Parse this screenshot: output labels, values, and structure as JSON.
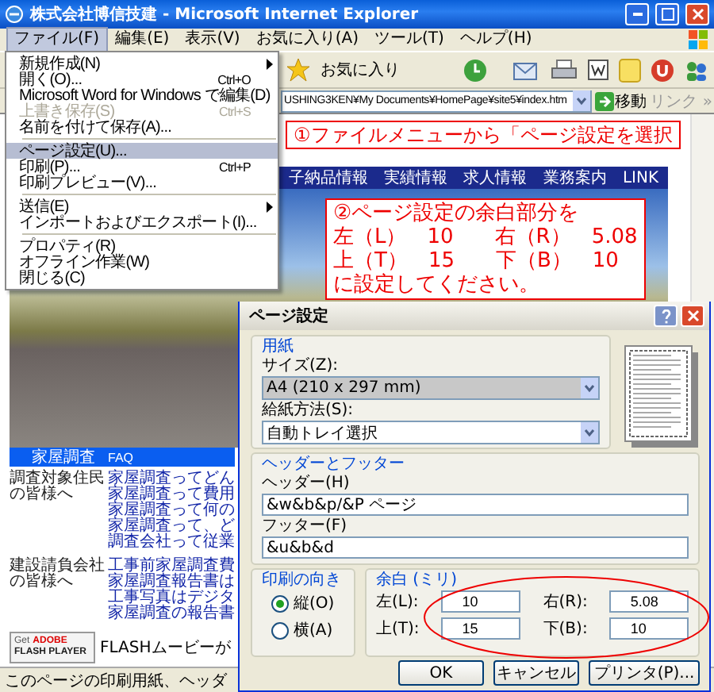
{
  "window": {
    "title": "株式会社博信技建 - Microsoft Internet Explorer"
  },
  "menu_bar": [
    {
      "label": "ファイル(F)",
      "selected": true
    },
    {
      "label": "編集(E)",
      "selected": false
    },
    {
      "label": "表示(V)",
      "selected": false
    },
    {
      "label": "お気に入り(A)",
      "selected": false
    },
    {
      "label": "ツール(T)",
      "selected": false
    },
    {
      "label": "ヘルプ(H)",
      "selected": false
    }
  ],
  "toolbar": {
    "favorites_label": "お気に入り"
  },
  "address_bar": {
    "value": "USHING3KEN¥My Documents¥HomePage¥site5¥index.htm",
    "go_label": "移動",
    "links_label": "リンク »"
  },
  "file_menu": [
    {
      "kind": "item",
      "label": "新規作成(N)",
      "submenu": true,
      "disabled": false,
      "selected": false
    },
    {
      "kind": "item",
      "label": "開く(O)...",
      "shortcut": "Ctrl+O",
      "submenu": false,
      "disabled": false,
      "selected": false
    },
    {
      "kind": "item",
      "label": "Microsoft Word for Windows で編集(D)",
      "submenu": false,
      "disabled": false,
      "selected": false
    },
    {
      "kind": "item",
      "label": "上書き保存(S)",
      "shortcut": "Ctrl+S",
      "submenu": false,
      "disabled": true,
      "selected": false
    },
    {
      "kind": "item",
      "label": "名前を付けて保存(A)...",
      "submenu": false,
      "disabled": false,
      "selected": false
    },
    {
      "kind": "separator"
    },
    {
      "kind": "item",
      "label": "ページ設定(U)...",
      "submenu": false,
      "disabled": false,
      "selected": true
    },
    {
      "kind": "item",
      "label": "印刷(P)...",
      "shortcut": "Ctrl+P",
      "submenu": false,
      "disabled": false,
      "selected": false
    },
    {
      "kind": "item",
      "label": "印刷プレビュー(V)...",
      "submenu": false,
      "disabled": false,
      "selected": false
    },
    {
      "kind": "separator"
    },
    {
      "kind": "item",
      "label": "送信(E)",
      "submenu": true,
      "disabled": false,
      "selected": false
    },
    {
      "kind": "item",
      "label": "インポートおよびエクスポート(I)...",
      "submenu": false,
      "disabled": false,
      "selected": false
    },
    {
      "kind": "separator"
    },
    {
      "kind": "item",
      "label": "プロパティ(R)",
      "submenu": false,
      "disabled": false,
      "selected": false
    },
    {
      "kind": "item",
      "label": "オフライン作業(W)",
      "submenu": false,
      "disabled": false,
      "selected": false
    },
    {
      "kind": "item",
      "label": "閉じる(C)",
      "submenu": false,
      "disabled": false,
      "selected": false
    }
  ],
  "page": {
    "nav": [
      "子納品情報",
      "実績情報",
      "求人情報",
      "業務案内",
      "LINK"
    ],
    "faq_bar": {
      "title": "家屋調査",
      "tag": "FAQ"
    },
    "sections": [
      {
        "heading": "調査対象住民の皆様へ",
        "links": [
          "家屋調査ってどん",
          "家屋調査って費用",
          "家屋調査って何の",
          "家屋調査って、ど",
          "調査会社って従業"
        ]
      },
      {
        "heading": "建設請負会社の皆様へ",
        "links": [
          "工事前家屋調査費",
          "家屋調査報告書は",
          "工事写真はデジタ",
          "家屋調査の報告書"
        ]
      }
    ],
    "flash_badge": {
      "get": "Get",
      "brand": "ADOBE",
      "product": "FLASH PLAYER"
    },
    "flash_note": "FLASHムービーが"
  },
  "callouts": [
    {
      "lines": [
        "①ファイルメニューから「ページ設定を選択"
      ]
    },
    {
      "lines": [
        "②ページ設定の余白部分を",
        "左（L）　10　　右（R）　5.08",
        "上（T）　15　　下（B）　10",
        "に設定してください。"
      ]
    }
  ],
  "dialog": {
    "title": "ページ設定",
    "paper": {
      "legend": "用紙",
      "size_label": "サイズ(Z):",
      "size_value": "A4 (210 x 297 mm)",
      "source_label": "給紙方法(S):",
      "source_value": "自動トレイ選択"
    },
    "header_footer": {
      "legend": "ヘッダーとフッター",
      "header_label": "ヘッダー(H)",
      "header_value": "&w&b&p/&P ページ",
      "footer_label": "フッター(F)",
      "footer_value": "&u&b&d"
    },
    "orientation": {
      "legend": "印刷の向き",
      "options": [
        {
          "label": "縦(O)",
          "selected": true
        },
        {
          "label": "横(A)",
          "selected": false
        }
      ]
    },
    "margins": {
      "legend": "余白 (ミリ)",
      "fields": [
        {
          "label": "左(L):",
          "value": "10"
        },
        {
          "label": "右(R):",
          "value": "5.08"
        },
        {
          "label": "上(T):",
          "value": "15"
        },
        {
          "label": "下(B):",
          "value": "10"
        }
      ]
    },
    "buttons": [
      "OK",
      "キャンセル",
      "プリンタ(P)..."
    ]
  },
  "status_bar": "このページの印刷用紙、ヘッダ"
}
